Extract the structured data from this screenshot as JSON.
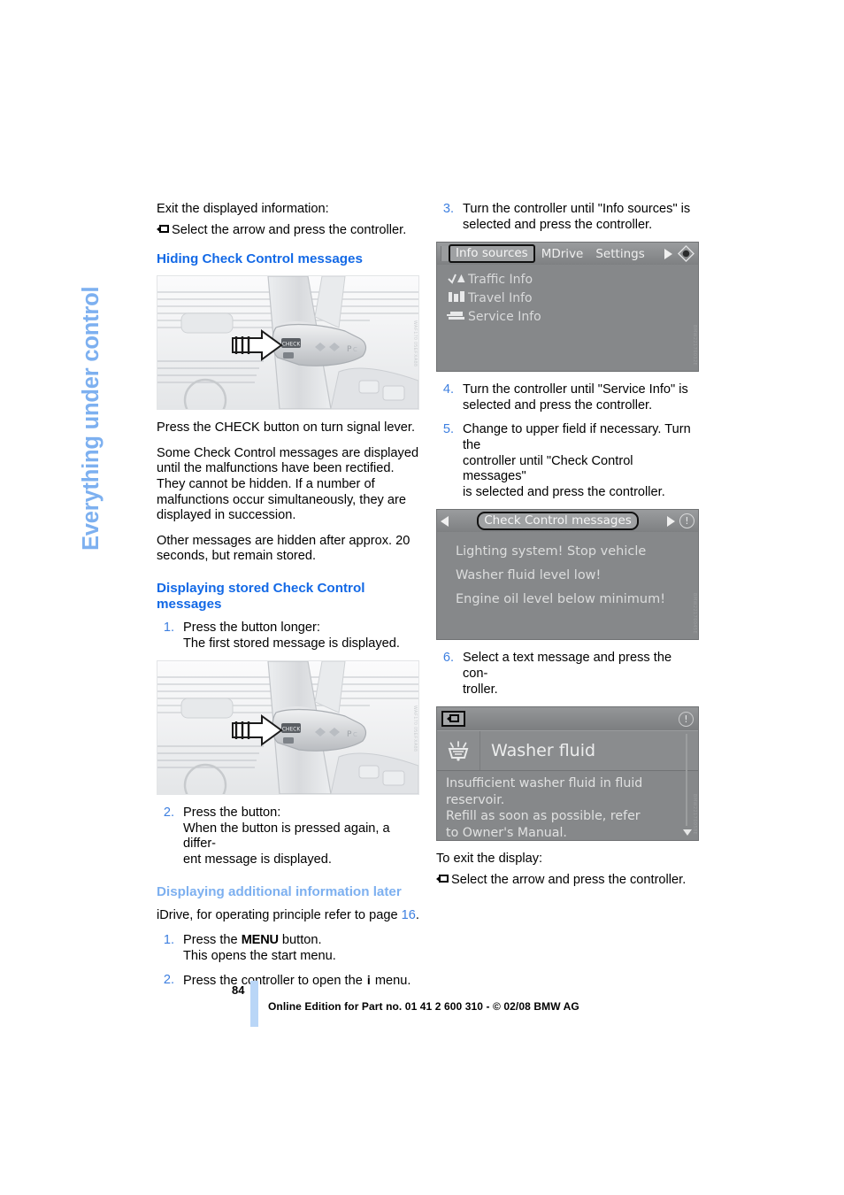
{
  "chapter": {
    "title": "Everything under control"
  },
  "left_column": {
    "exit_info_line": "Exit the displayed information:",
    "exit_info_action": "Select the arrow and press the controller.",
    "heading_hiding": "Hiding Check Control messages",
    "photo1": {
      "alt": "Turn signal lever with CHECK button",
      "id_code": "WAF170 05EFXA88"
    },
    "para_press_check": "Press the CHECK button on turn signal lever.",
    "para_some_messages": "Some Check Control messages are displayed until the malfunctions have been rectified. They cannot be hidden. If a number of malfunctions occur simultaneously, they are displayed in succession.",
    "para_other_messages": "Other messages are hidden after approx. 20 seconds, but remain stored.",
    "heading_stored": "Displaying stored Check Control messages",
    "step1_num": "1.",
    "step1_line1": "Press the button longer:",
    "step1_line2": "The first stored message is displayed.",
    "photo2": {
      "alt": "Turn signal lever with CHECK button",
      "id_code": "WAF170 05EFXA88"
    },
    "step2_num": "2.",
    "step2_line1": "Press the button:",
    "step2_line2": "When the button is pressed again, a differ-",
    "step2_line3": "ent message is displayed.",
    "heading_additional": "Displaying additional information later",
    "idrive_note_a": "iDrive, for operating principle refer to page ",
    "idrive_note_page": "16",
    "idrive_note_b": ".",
    "step_m1_num": "1.",
    "step_m1_pre": "Press the ",
    "step_m1_menu": "MENU",
    "step_m1_post": " button.",
    "step_m1_line2": "This opens the start menu.",
    "step_m2_num": "2.",
    "step_m2_pre": "Press the controller to open the ",
    "step_m2_icon": "i",
    "step_m2_post": " menu."
  },
  "right_column": {
    "step3_num": "3.",
    "step3_line1": "Turn the controller until \"Info sources\" is",
    "step3_line2": "selected and press the controller.",
    "screen_info_sources": {
      "tabs": [
        {
          "label": "Info sources",
          "selected": true
        },
        {
          "label": "MDrive",
          "selected": false
        },
        {
          "label": "Settings",
          "selected": false
        }
      ],
      "rows": [
        {
          "icon": "traffic-info-icon",
          "label": "Traffic Info"
        },
        {
          "icon": "travel-info-icon",
          "label": "Travel Info"
        },
        {
          "icon": "service-info-icon",
          "label": "Service Info"
        }
      ],
      "id_code": "BMW22170032E"
    },
    "step4_num": "4.",
    "step4_line1": "Turn the controller until \"Service Info\" is",
    "step4_line2": "selected and press the controller.",
    "step5_num": "5.",
    "step5_line1": "Change to upper field if necessary. Turn the",
    "step5_line2": "controller until \"Check Control messages\"",
    "step5_line3": "is selected and press the controller.",
    "screen_check_control": {
      "title": "Check Control messages",
      "messages": [
        "Lighting system! Stop vehicle",
        "Washer fluid level low!",
        "Engine oil level below minimum!"
      ],
      "id_code": "BMW22170045E"
    },
    "step6_num": "6.",
    "step6_line1": "Select a text message and press the con-",
    "step6_line2": "troller.",
    "screen_washer_fluid": {
      "title": "Washer fluid",
      "icon": "washer-fluid-icon",
      "body_lines": [
        "Insufficient washer fluid in fluid",
        "reservoir.",
        "Refill as soon as possible, refer",
        "to Owner's Manual."
      ],
      "id_code": "BMW22170058E"
    },
    "exit_display_line": "To exit the display:",
    "exit_display_action": "Select the arrow and press the controller."
  },
  "footer": {
    "page_number": "84",
    "notice": "Online Edition for Part no. 01 41 2 600 310 - © 02/08 BMW AG"
  },
  "colors": {
    "heading_blue": "#1369e6",
    "heading_light_blue": "#7db0f0",
    "step_number_blue": "#3d7fe0",
    "footer_bar": "#b9d6f7"
  }
}
